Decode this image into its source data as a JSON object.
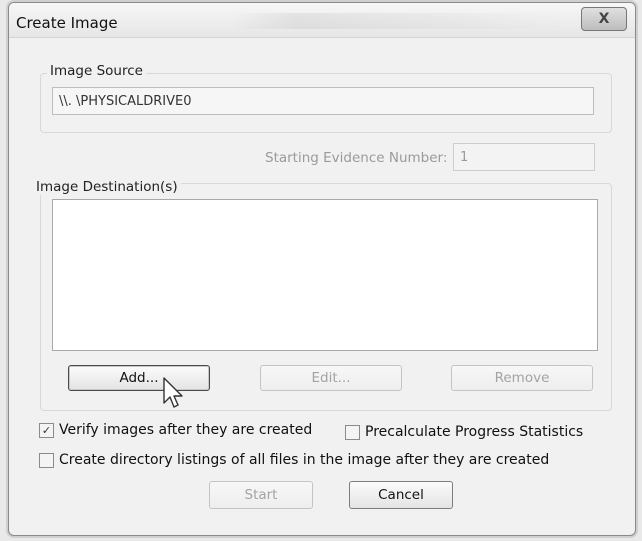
{
  "window": {
    "title": "Create Image",
    "close_glyph": "X"
  },
  "image_source": {
    "group_label": "Image Source",
    "path_value": "\\\\. \\PHYSICALDRIVE0"
  },
  "starting_evidence": {
    "label": "Starting Evidence Number:",
    "value": "1"
  },
  "image_destination": {
    "group_label": "Image Destination(s)",
    "items": [],
    "add_label": "Add...",
    "edit_label": "Edit...",
    "remove_label": "Remove"
  },
  "options": {
    "verify": {
      "label": "Verify images after they are created",
      "checked": true,
      "check_glyph": "✓"
    },
    "precalculate": {
      "label": "Precalculate Progress Statistics",
      "checked": false
    },
    "directory_listings": {
      "label": "Create directory listings of all files in the image after they are created",
      "checked": false
    }
  },
  "footer": {
    "start_label": "Start",
    "cancel_label": "Cancel"
  },
  "icons": {
    "cursor": "arrow-pointer-icon",
    "close": "close-icon",
    "check": "checkmark-icon"
  }
}
